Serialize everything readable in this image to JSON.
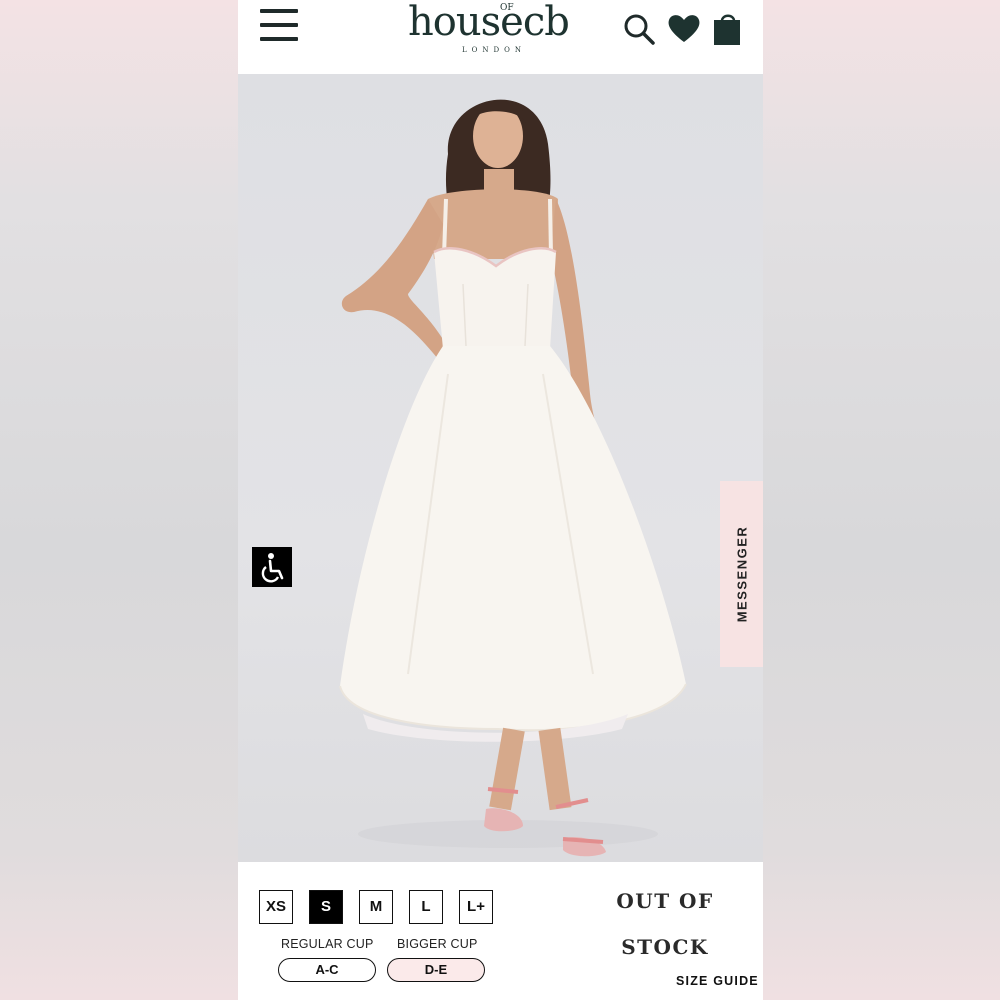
{
  "header": {
    "logo_main": "house",
    "logo_of": "OF",
    "logo_cb": "cb",
    "logo_sub": "LONDON",
    "icons": [
      "menu-icon",
      "search-icon",
      "heart-icon",
      "shopping-bag-icon"
    ]
  },
  "floating": {
    "messenger_label": "MESSENGER",
    "accessibility_icon": "wheelchair-icon"
  },
  "sizes": {
    "options": [
      "XS",
      "S",
      "M",
      "L",
      "L+"
    ],
    "selected": "S"
  },
  "cups": {
    "regular_label": "REGULAR CUP",
    "bigger_label": "BIGGER CUP",
    "regular_value": "A-C",
    "bigger_value": "D-E"
  },
  "status": {
    "line1": "OUT OF",
    "line2": "STOCK"
  },
  "size_guide_label": "SIZE GUIDE",
  "colors": {
    "brand": "#1e3330",
    "messenger_bg": "#f7e3e3",
    "bigger_cup_bg": "#fbeaea"
  }
}
